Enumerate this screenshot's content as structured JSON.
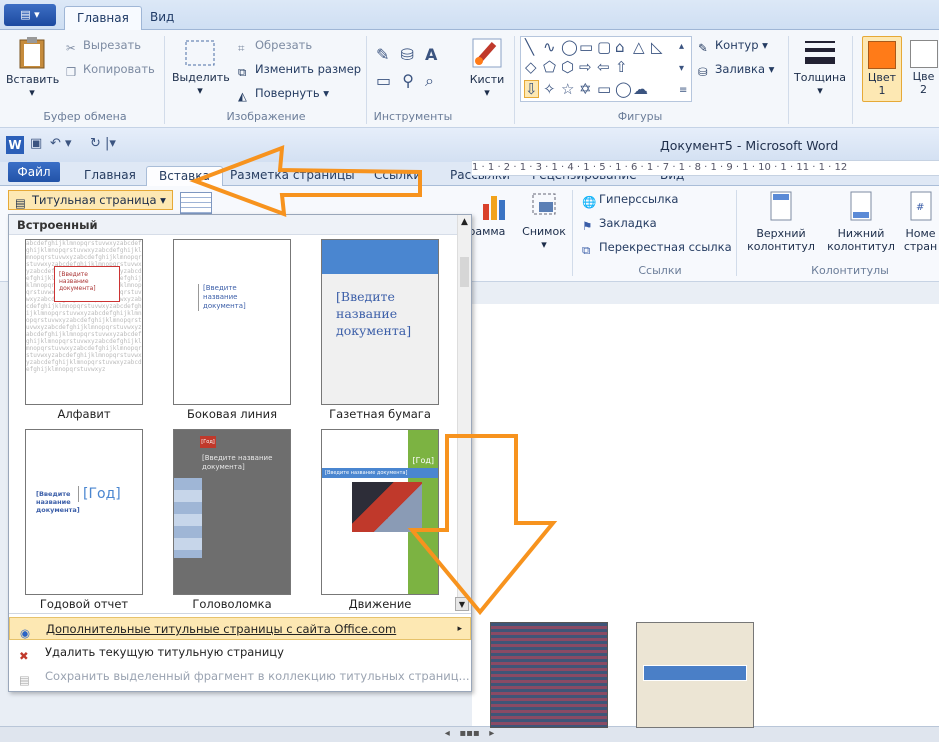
{
  "paint": {
    "tabs": [
      "Главная",
      "Вид"
    ],
    "paste_label": "Вставить",
    "clipboard": {
      "cut": "Вырезать",
      "copy": "Копировать",
      "group": "Буфер обмена"
    },
    "image": {
      "select": "Выделить",
      "crop": "Обрезать",
      "resize": "Изменить размер",
      "rotate": "Повернуть",
      "group": "Изображение"
    },
    "tools_group": "Инструменты",
    "brushes": "Кисти",
    "shapes": {
      "outline": "Контур",
      "fill": "Заливка",
      "group": "Фигуры"
    },
    "thickness": "Толщина",
    "color1": "Цвет 1",
    "color2": "Цве 2"
  },
  "word": {
    "title": "Документ5 - Microsoft Word",
    "tabs": [
      "Файл",
      "Главная",
      "Вставка",
      "Разметка страницы",
      "Ссылки",
      "Рассылки",
      "Рецензирование",
      "Вид"
    ],
    "cover_button": "Титульная страница",
    "chart_label": "грамма",
    "snapshot_label": "Снимок",
    "links": {
      "hyperlink": "Гиперссылка",
      "bookmark": "Закладка",
      "crossref": "Перекрестная ссылка",
      "group": "Ссылки"
    },
    "headers": {
      "header": "Верхний колонтитул",
      "footer": "Нижний колонтитул",
      "page_number": "Номе стран",
      "group": "Колонтитулы"
    },
    "ruler_text": "1 · 1 · 2 · 1 · 3 · 1 · 4 · 1 · 5 · 1 · 6 · 1 · 7 · 1 · 8 · 1 · 9 · 1 · 10 · 1 · 11 · 1 · 12"
  },
  "dropdown": {
    "header": "Встроенный",
    "thumbnails": [
      {
        "label": "Алфавит",
        "title": "[Введите название документа]"
      },
      {
        "label": "Боковая линия",
        "title": "[Введите название документа]"
      },
      {
        "label": "Газетная бумага",
        "title": "[Введите название документа]"
      },
      {
        "label": "Годовой отчет",
        "title": "[Введите название документа]",
        "year": "[Год]"
      },
      {
        "label": "Головоломка",
        "title": "[Введите название документа]",
        "year": "[Год]"
      },
      {
        "label": "Движение",
        "title": "[Введите название документа]",
        "year": "[Год]"
      }
    ],
    "menu": [
      {
        "label": "Дополнительные титульные страницы с сайта Office.com",
        "disabled": false
      },
      {
        "label": "Удалить текущую титульную страницу",
        "disabled": false
      },
      {
        "label": "Сохранить выделенный фрагмент в коллекцию титульных страниц...",
        "disabled": true
      }
    ]
  },
  "colors": {
    "accent_orange": "#f7931e",
    "ribbon_blue": "#2253a8"
  }
}
